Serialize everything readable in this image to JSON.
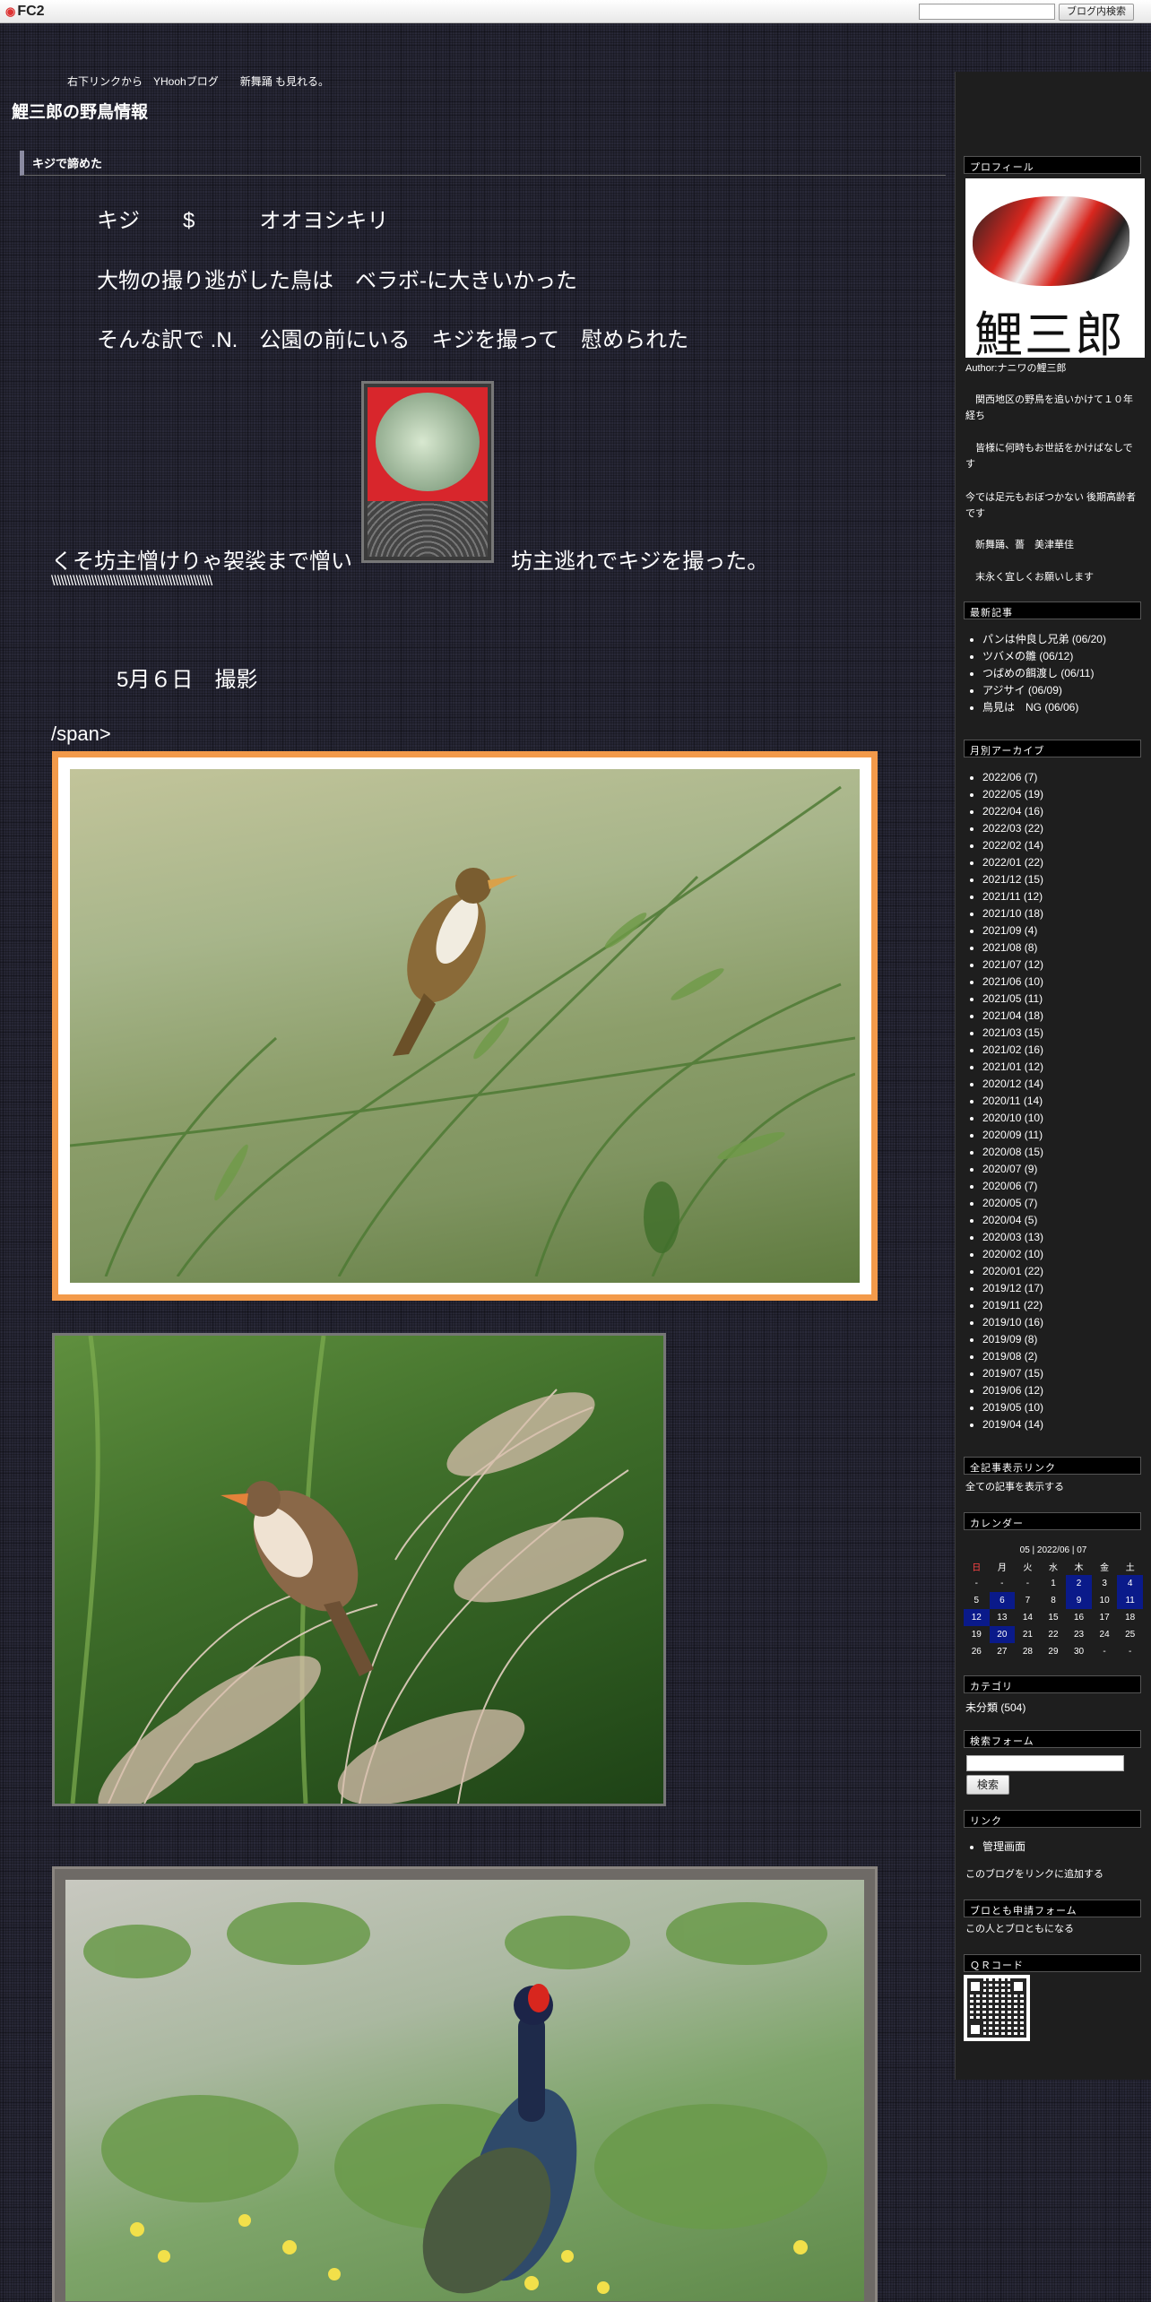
{
  "fc2bar": {
    "logo": "FC2",
    "search_button": "ブログ内検索"
  },
  "header": {
    "subhead": "右下リンクから　YHoohブログ　　新舞踊 も見れる。",
    "title": "鯉三郎の野鳥情報"
  },
  "entry": {
    "title": "キジで諦めた",
    "line1": "キジ　　$　　　オオヨシキリ",
    "line2": "大物の撮り逃がした鳥は　ベラボ-に大きいかった",
    "line3": "そんな訳で .N.　公園の前にいる　キジを撮って　慰められた",
    "line4a": "くそ坊主憎けりゃ袈裟まで憎い",
    "line4b": "坊主逃れでキジを撮った。",
    "slashes": "\\\\\\\\\\\\\\\\\\\\\\\\\\\\\\\\\\\\\\\\\\\\\\\\\\\\\\\\\\\\\\\\\\\\\\\\\\\\\\\\\\\\\\\\\\\\\\\\\\\\\\\\",
    "date": "5月６日　撮影",
    "stray": "/span>"
  },
  "sidebar": {
    "profile_head": "プロフィール",
    "avatar_text": "鯉三郎",
    "author": "Author:ナニワの鯉三郎",
    "bio1": "　関西地区の野鳥を追いかけて１０年経ち",
    "bio2": "　皆様に何時もお世話をかけばなしです",
    "bio3": "今では足元もおぼつかない 後期高齢者です",
    "bio4": "　新舞踊、薔　美津華佳",
    "bio5": "　末永く宜しくお願いします",
    "recent_head": "最新記事",
    "recent": [
      "パンは仲良し兄弟 (06/20)",
      "ツバメの雛 (06/12)",
      "つばめの餌渡し (06/11)",
      "アジサイ (06/09)",
      "鳥見は　NG (06/06)"
    ],
    "archive_head": "月別アーカイブ",
    "archive": [
      "2022/06 (7)",
      "2022/05 (19)",
      "2022/04 (16)",
      "2022/03 (22)",
      "2022/02 (14)",
      "2022/01 (22)",
      "2021/12 (15)",
      "2021/11 (12)",
      "2021/10 (18)",
      "2021/09 (4)",
      "2021/08 (8)",
      "2021/07 (12)",
      "2021/06 (10)",
      "2021/05 (11)",
      "2021/04 (18)",
      "2021/03 (15)",
      "2021/02 (16)",
      "2021/01 (12)",
      "2020/12 (14)",
      "2020/11 (14)",
      "2020/10 (10)",
      "2020/09 (11)",
      "2020/08 (15)",
      "2020/07 (9)",
      "2020/06 (7)",
      "2020/05 (7)",
      "2020/04 (5)",
      "2020/03 (13)",
      "2020/02 (10)",
      "2020/01 (22)",
      "2019/12 (17)",
      "2019/11 (22)",
      "2019/10 (16)",
      "2019/09 (8)",
      "2019/08 (2)",
      "2019/07 (15)",
      "2019/06 (12)",
      "2019/05 (10)",
      "2019/04 (14)"
    ],
    "allentries_head": "全記事表示リンク",
    "allentries_link": "全ての記事を表示する",
    "calendar_head": "カレンダー",
    "calendar_title": "05 | 2022/06 | 07",
    "calendar_days": [
      "日",
      "月",
      "火",
      "水",
      "木",
      "金",
      "土"
    ],
    "calendar_rows": [
      [
        "-",
        "-",
        "-",
        "1",
        "2",
        "3",
        "4"
      ],
      [
        "5",
        "6",
        "7",
        "8",
        "9",
        "10",
        "11"
      ],
      [
        "12",
        "13",
        "14",
        "15",
        "16",
        "17",
        "18"
      ],
      [
        "19",
        "20",
        "21",
        "22",
        "23",
        "24",
        "25"
      ],
      [
        "26",
        "27",
        "28",
        "29",
        "30",
        "-",
        "-"
      ]
    ],
    "category_head": "カテゴリ",
    "category": "未分類 (504)",
    "search_head": "検索フォーム",
    "search_button": "検索",
    "links_head": "リンク",
    "links": [
      "管理画面"
    ],
    "links_add": "このブログをリンクに追加する",
    "friend_head": "ブロとも申請フォーム",
    "friend_link": "この人とブロともになる",
    "qr_head": "ＱＲコード"
  }
}
